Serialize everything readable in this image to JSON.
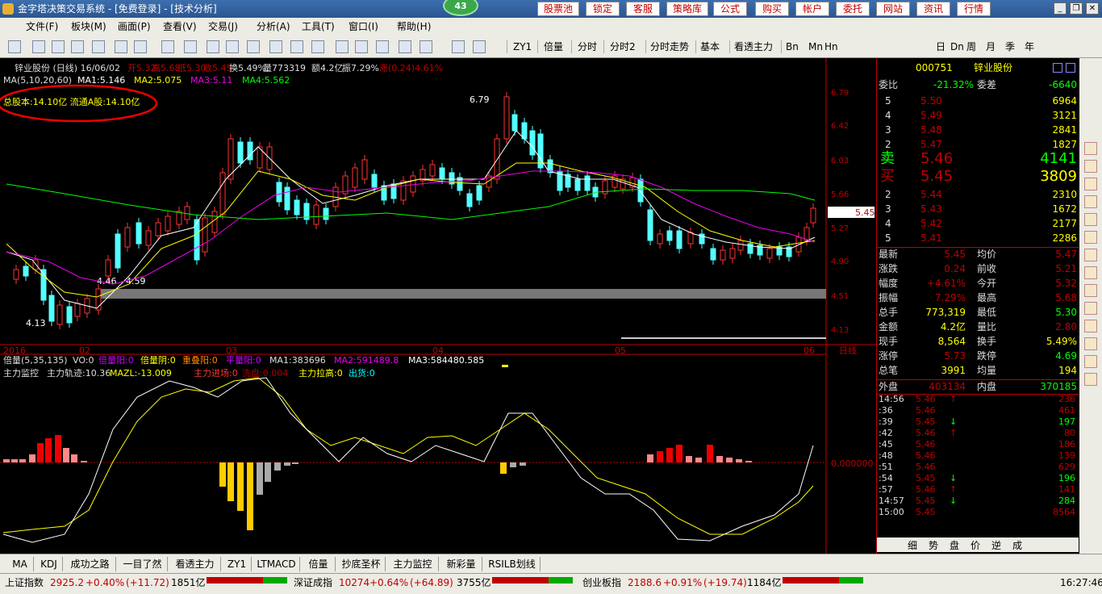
{
  "title": "金字塔决策交易系统 - [免费登录] - [技术分析]",
  "badge": "43",
  "top_buttons": [
    "股票池",
    "锁定",
    "客服",
    "策略库",
    "公式",
    "购买",
    "帐户",
    "委托",
    "网站",
    "资讯",
    "行情"
  ],
  "menu": [
    "文件(F)",
    "板块(M)",
    "画面(P)",
    "查看(V)",
    "交易(J)",
    "分析(A)",
    "工具(T)",
    "窗口(I)",
    "帮助(H)"
  ],
  "toolbar": [
    "ZY1",
    "倍量",
    "分时",
    "分时2",
    "分时走势",
    "基本",
    "看透主力",
    "Bn",
    "Mn",
    "Hn",
    "日",
    "Dn",
    "周",
    "月",
    "季",
    "年"
  ],
  "chart_header": {
    "name": "锌业股份 (日线) 16/06/02",
    "open": "开5.32",
    "high": "高5.68",
    "low": "低5.30",
    "close": "收5.45",
    "turnover": "换5.49%",
    "volume": "量773319",
    "amount": "额4.2亿",
    "amplitude": "振7.29%",
    "change": "涨(0.24)4.61%"
  },
  "ma_line": {
    "label": "MA(5,10,20,60)",
    "ma1": "MA1:5.146",
    "ma2": "MA2:5.075",
    "ma3": "MA3:5.11",
    "ma4": "MA4:5.562"
  },
  "share_info": "总股本:14.10亿 流通A股:14.10亿",
  "price_labels": {
    "peak": "6.79",
    "p1": "4.46",
    "p2": "4.59",
    "low": "4.13",
    "current": "5.45"
  },
  "y_ticks": [
    "6.79",
    "6.42",
    "6.03",
    "5.66",
    "5.27",
    "4.90",
    "4.51",
    "4.13"
  ],
  "x_ticks": [
    "2016",
    "02",
    "03",
    "04",
    "05",
    "06"
  ],
  "period_label": "日线",
  "volume_line": {
    "label": "倍量(5,35,135)",
    "vo": "VO:0",
    "a": "倍量阳:0",
    "b": "倍量阴:0",
    "c": "重叠阳:0",
    "d": "平量阳:0",
    "ma1": "MA1:383696",
    "ma2": "MA2:591489.8",
    "ma3": "MA3:584480.585"
  },
  "indicator_line": {
    "name": "主力监控",
    "a": "主力轨迹:10.36",
    "b": "MAZL:-13.009",
    "c": "主力进场:0",
    "d": "洗盘:0.004",
    "e": "主力拉高:0",
    "f": "出货:0"
  },
  "zero_label": "0.000000",
  "quote": {
    "code": "000751",
    "name": "锌业股份",
    "weibi_label": "委比",
    "weibi": "-21.32%",
    "weicha_label": "委差",
    "weicha": "-6640",
    "asks": [
      {
        "l": "5",
        "p": "5.50",
        "v": "6964"
      },
      {
        "l": "4",
        "p": "5.49",
        "v": "3121"
      },
      {
        "l": "3",
        "p": "5.48",
        "v": "2841"
      },
      {
        "l": "2",
        "p": "5.47",
        "v": "1827"
      }
    ],
    "sell_label": "卖",
    "sell_price": "5.46",
    "sell_vol": "4141",
    "buy_label": "买",
    "buy_price": "5.45",
    "buy_vol": "3809",
    "bids": [
      {
        "l": "2",
        "p": "5.44",
        "v": "2310"
      },
      {
        "l": "3",
        "p": "5.43",
        "v": "1672"
      },
      {
        "l": "4",
        "p": "5.42",
        "v": "2177"
      },
      {
        "l": "5",
        "p": "5.41",
        "v": "2286"
      }
    ],
    "stats": [
      [
        "最新",
        "5.45",
        "均价",
        "5.47"
      ],
      [
        "涨跌",
        "0.24",
        "前收",
        "5.21"
      ],
      [
        "幅度",
        "+4.61%",
        "今开",
        "5.32"
      ],
      [
        "振幅",
        "7.29%",
        "最高",
        "5.68"
      ],
      [
        "总手",
        "773,319",
        "最低",
        "5.30"
      ],
      [
        "金额",
        "4.2亿",
        "量比",
        "2.80"
      ],
      [
        "现手",
        "8,564",
        "换手",
        "5.49%"
      ],
      [
        "涨停",
        "5.73",
        "跌停",
        "4.69"
      ],
      [
        "总笔",
        "3991",
        "均量",
        "194"
      ]
    ],
    "outer_label": "外盘",
    "outer": "403134",
    "inner_label": "内盘",
    "inner": "370185",
    "ticks": [
      [
        "14:56",
        "5.46",
        "↑",
        "236"
      ],
      [
        ":36",
        "5.46",
        "",
        "461"
      ],
      [
        ":39",
        "5.45",
        "↓",
        "197"
      ],
      [
        ":42",
        "5.46",
        "↑",
        "80"
      ],
      [
        ":45",
        "5.46",
        "",
        "186"
      ],
      [
        ":48",
        "5.46",
        "",
        "139"
      ],
      [
        ":51",
        "5.46",
        "",
        "629"
      ],
      [
        ":54",
        "5.45",
        "↓",
        "196"
      ],
      [
        ":57",
        "5.46",
        "↑",
        "141"
      ],
      [
        "14:57",
        "5.45",
        "↓",
        "284"
      ],
      [
        "15:00",
        "5.45",
        "",
        "8564"
      ]
    ],
    "bottom_tabs": [
      "细",
      "势",
      "盘",
      "价",
      "逆",
      "成"
    ]
  },
  "indicator_tabs": [
    "MA",
    "KDJ",
    "成功之路",
    "一目了然",
    "看透主力",
    "ZY1",
    "LTMACD",
    "倍量",
    "抄底圣杯",
    "主力监控",
    "新彩量",
    "RSILB划线"
  ],
  "status": {
    "sh_name": "上证指数",
    "sh_val": "2925.2",
    "sh_chg": "+0.40%",
    "sh_pts": "(+11.72)",
    "sh_amt": "1851亿",
    "sz_name": "深证成指",
    "sz_val": "10274",
    "sz_chg": "+0.64%",
    "sz_pts": "(+64.89)",
    "sz_amt": "3755亿",
    "cy_name": "创业板指",
    "cy_val": "2188.6",
    "cy_chg": "+0.91%",
    "cy_pts": "(+19.74)",
    "cy_amt": "1184亿",
    "time": "16:27:46"
  }
}
